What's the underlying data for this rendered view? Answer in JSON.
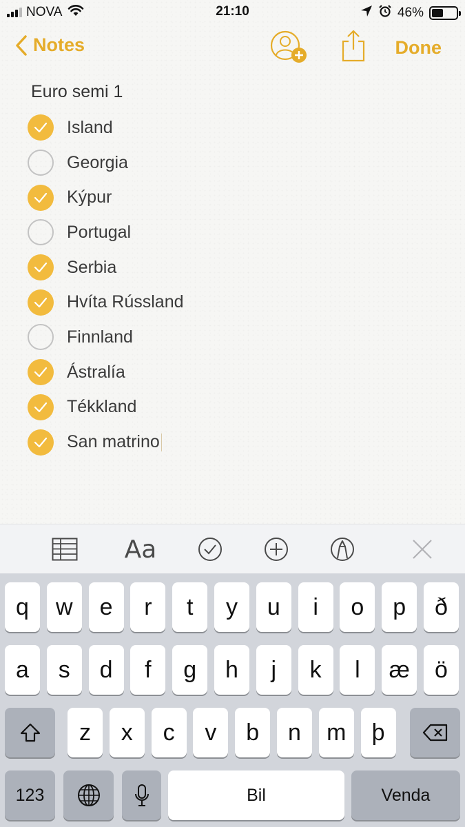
{
  "status_bar": {
    "carrier": "NOVA",
    "time": "21:10",
    "battery_percent": "46%",
    "battery_level": 0.46,
    "icons": [
      "signal-icon",
      "wifi-icon",
      "location-icon",
      "alarm-icon",
      "battery-icon"
    ]
  },
  "nav": {
    "back_label": "Notes",
    "done_label": "Done",
    "accent_color": "#e5ac2a"
  },
  "note": {
    "title": "Euro semi 1",
    "items": [
      {
        "text": "Island",
        "checked": true
      },
      {
        "text": "Georgia",
        "checked": false
      },
      {
        "text": "Kýpur",
        "checked": true
      },
      {
        "text": "Portugal",
        "checked": false
      },
      {
        "text": "Serbia",
        "checked": true
      },
      {
        "text": "Hvíta Rússland",
        "checked": true
      },
      {
        "text": "Finnland",
        "checked": false
      },
      {
        "text": "Ástralía",
        "checked": true
      },
      {
        "text": "Tékkland",
        "checked": true
      },
      {
        "text": "San matrino",
        "checked": true
      }
    ],
    "check_color": "#f2bb3e"
  },
  "toolbar": {
    "text_format_label": "Aa",
    "icons": [
      "table-icon",
      "text-format-icon",
      "checklist-icon",
      "add-icon",
      "markup-icon",
      "close-icon"
    ]
  },
  "keyboard": {
    "row1": [
      "q",
      "w",
      "e",
      "r",
      "t",
      "y",
      "u",
      "i",
      "o",
      "p",
      "ð"
    ],
    "row2": [
      "a",
      "s",
      "d",
      "f",
      "g",
      "h",
      "j",
      "k",
      "l",
      "æ",
      "ö"
    ],
    "row3": [
      "z",
      "x",
      "c",
      "v",
      "b",
      "n",
      "m",
      "þ"
    ],
    "numbers_label": "123",
    "space_label": "Bil",
    "return_label": "Venda"
  }
}
